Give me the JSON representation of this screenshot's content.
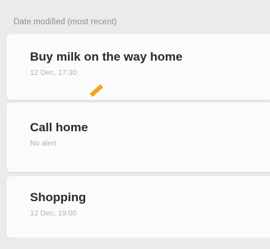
{
  "list": {
    "sort_label": "Date modified (most recent)",
    "items": [
      {
        "title": "Buy milk on the way home",
        "subtitle": "12 Dec, 17:30"
      },
      {
        "title": "Call home",
        "subtitle": "No alert"
      },
      {
        "title": "Shopping",
        "subtitle": "12 Dec, 19:00"
      }
    ]
  },
  "colors": {
    "background": "#ebebeb",
    "card": "#fbfbfb",
    "title_text": "#2a2a2a",
    "subtitle_text": "#b3b3b3",
    "marker": "#f7a21b"
  }
}
